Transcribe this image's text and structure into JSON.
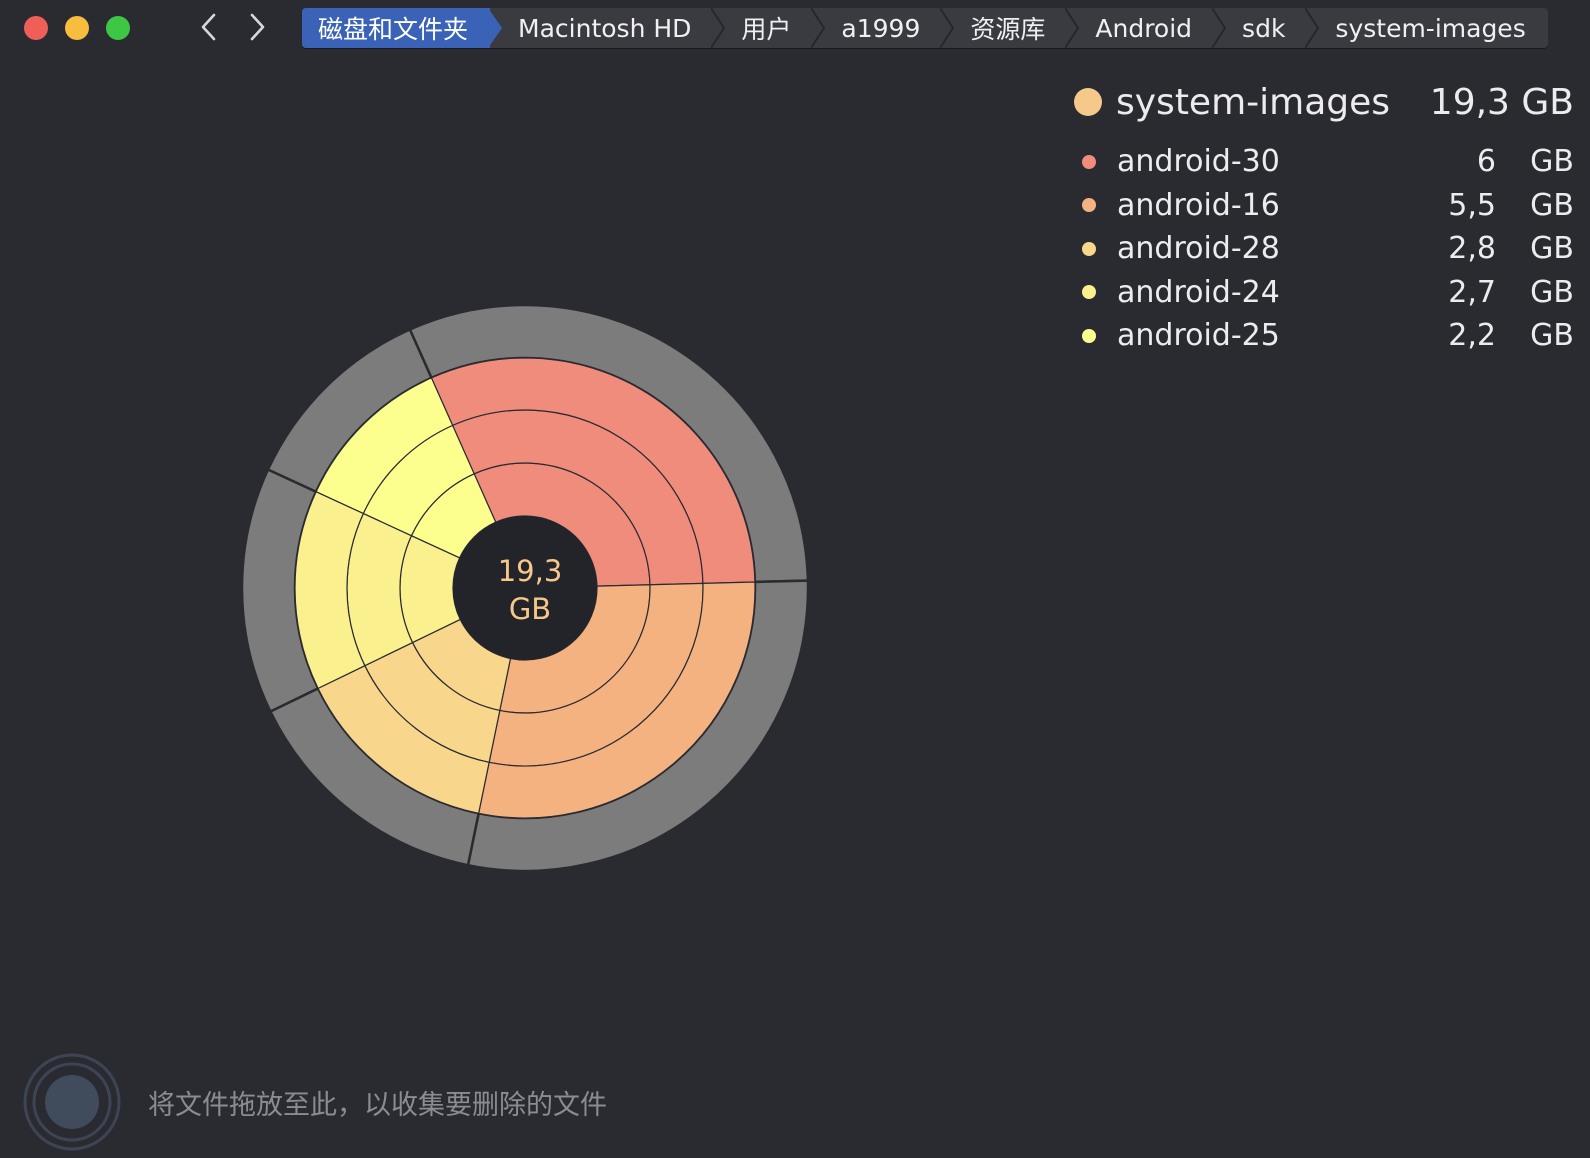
{
  "breadcrumb": [
    "磁盘和文件夹",
    "Macintosh HD",
    "用户",
    "a1999",
    "资源库",
    "Android",
    "sdk",
    "system-images"
  ],
  "center": {
    "value": "19,3",
    "unit": "GB"
  },
  "legend": {
    "head": {
      "name": "system-images",
      "size": "19,3 GB",
      "color": "#f6c98b"
    },
    "items": [
      {
        "name": "android-30",
        "num": "6",
        "unit": "GB",
        "color": "#f08c7c"
      },
      {
        "name": "android-16",
        "num": "5,5",
        "unit": "GB",
        "color": "#f4b281"
      },
      {
        "name": "android-28",
        "num": "2,8",
        "unit": "GB",
        "color": "#f8d78c"
      },
      {
        "name": "android-24",
        "num": "2,7",
        "unit": "GB",
        "color": "#fbf08e"
      },
      {
        "name": "android-25",
        "num": "2,2",
        "unit": "GB",
        "color": "#fcff8e"
      }
    ]
  },
  "dropzone": {
    "text": "将文件拖放至此，以收集要删除的文件"
  },
  "colors": {
    "background": "#2a2b31",
    "accent": "#3a63b7",
    "ring_gray": "#7c7c7c",
    "slice_line": "#2a2b31"
  },
  "icons": [
    "close-button",
    "minimize-button",
    "zoom-button",
    "chevron-left-icon",
    "chevron-right-icon",
    "drop-target-icon"
  ]
}
